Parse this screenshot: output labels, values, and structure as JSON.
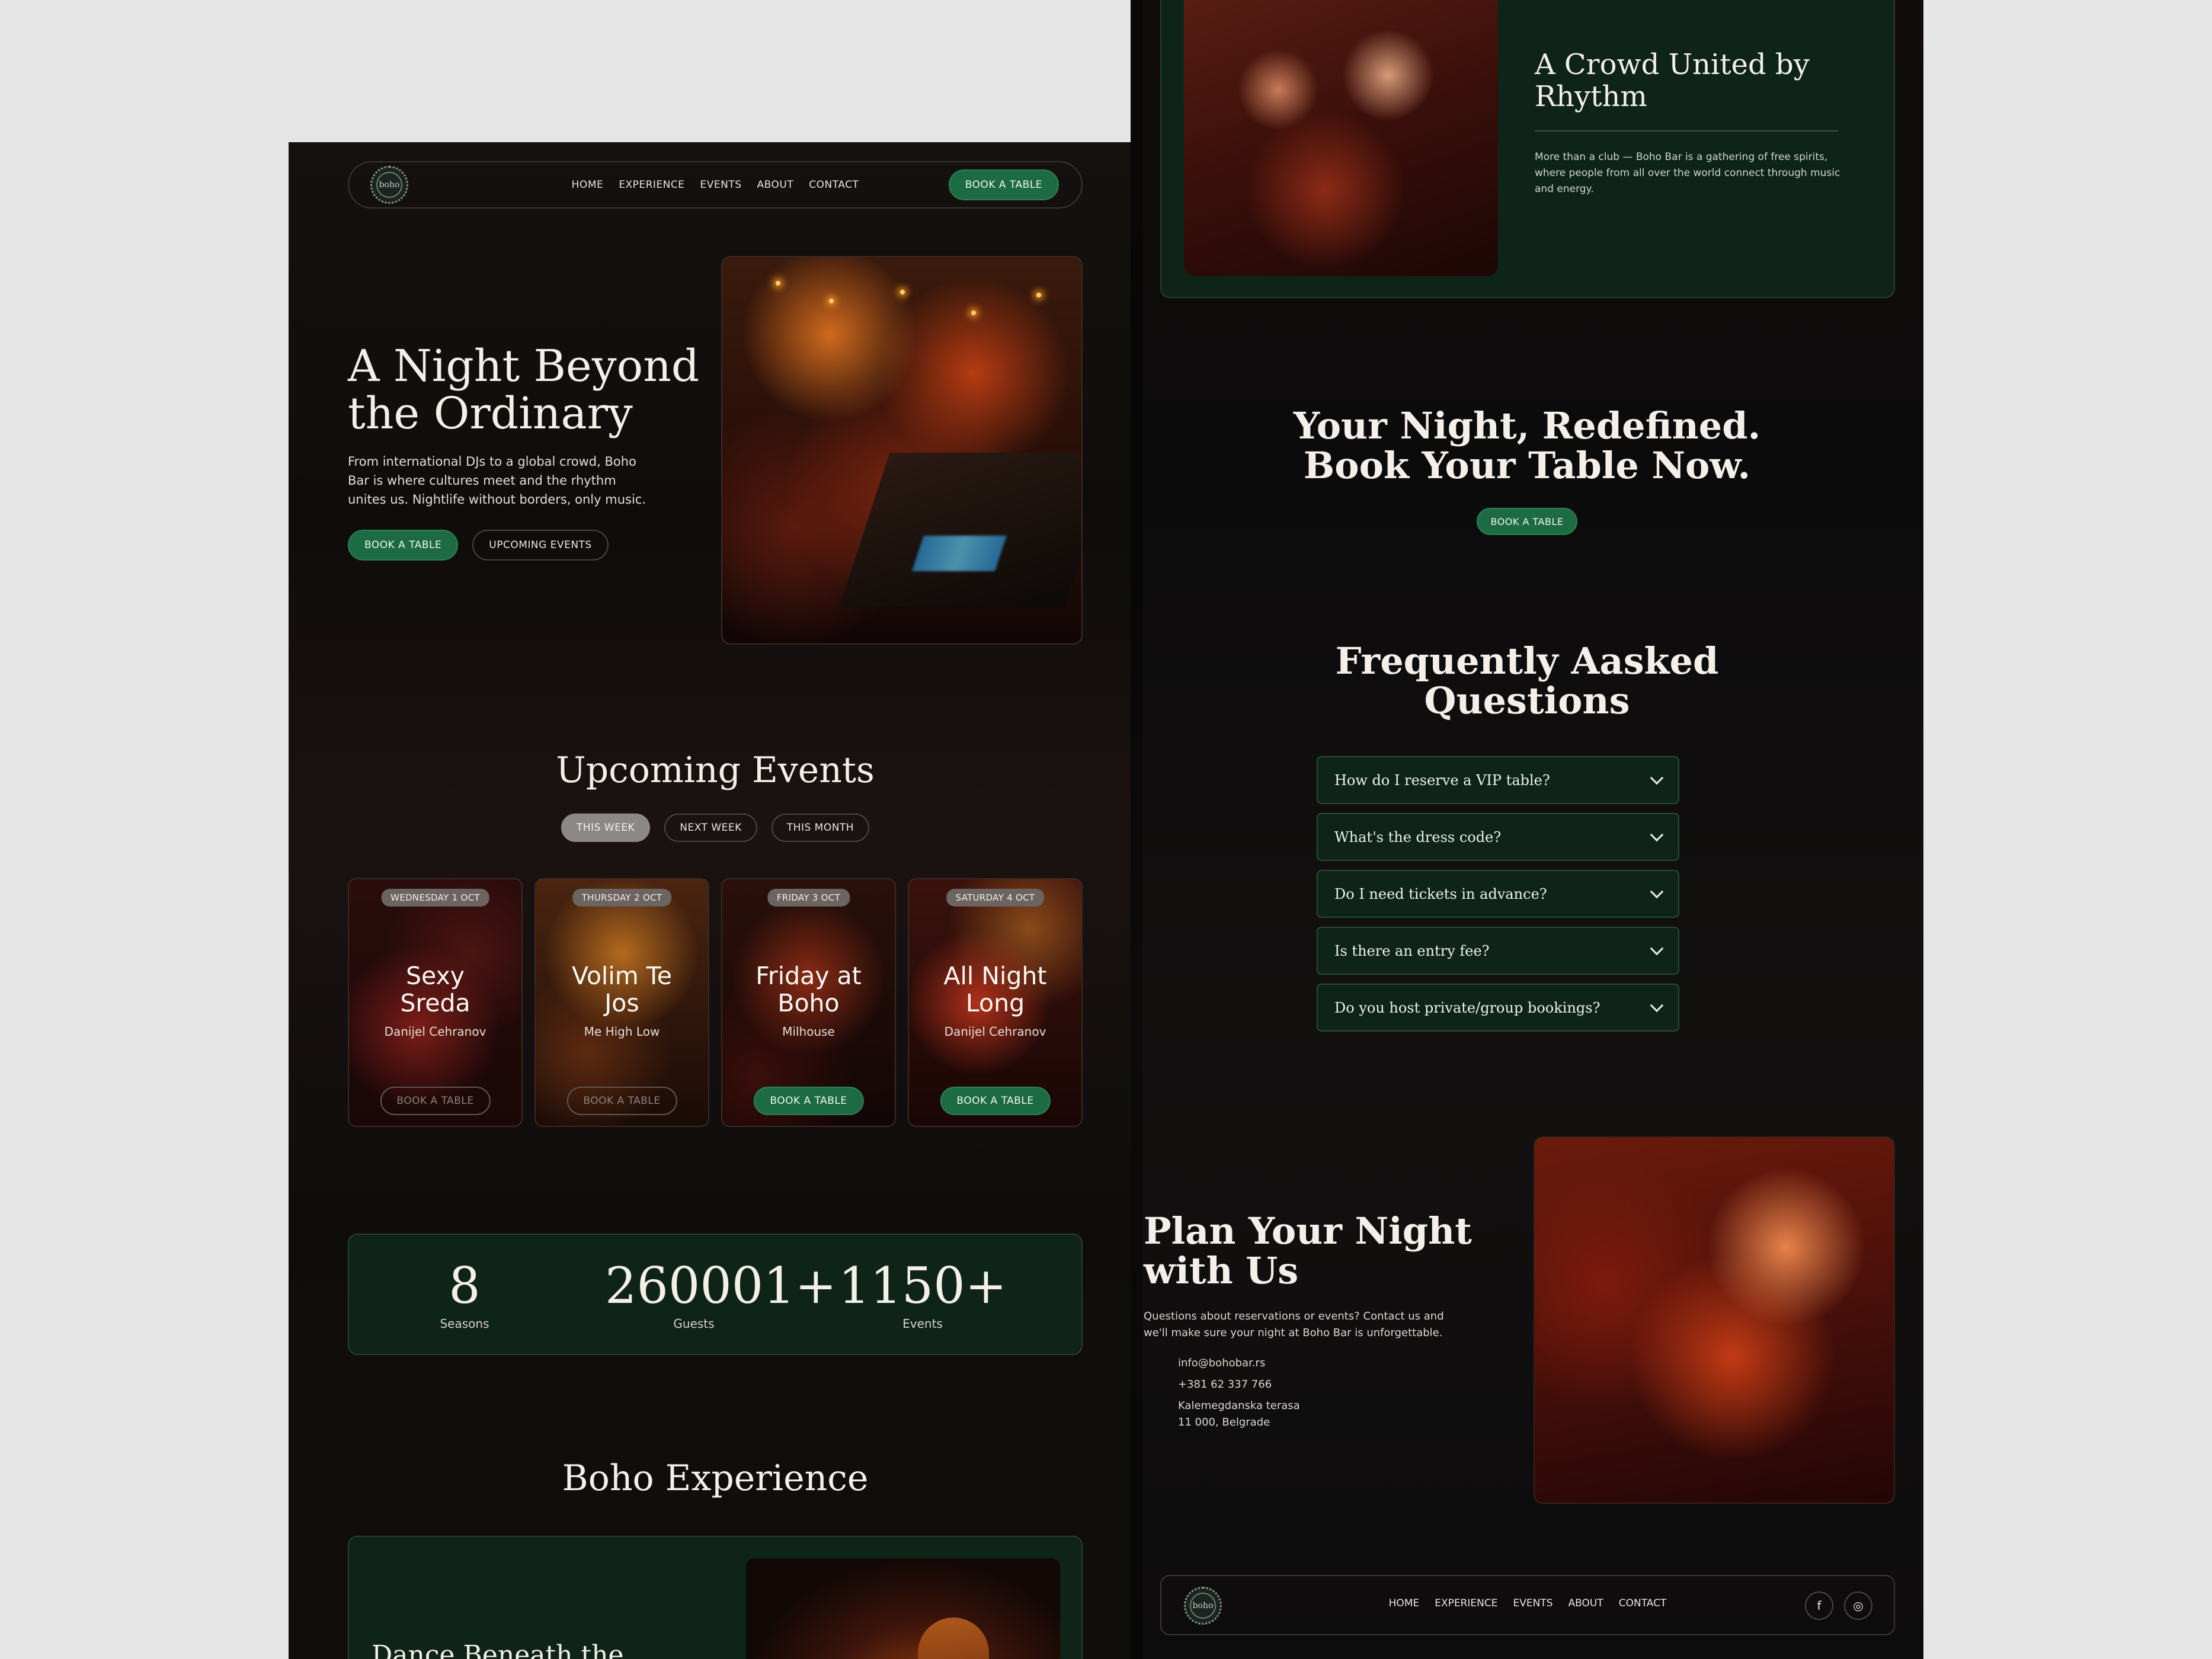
{
  "nav": {
    "links": [
      "HOME",
      "EXPERIENCE",
      "EVENTS",
      "ABOUT",
      "CONTACT"
    ],
    "cta": "BOOK A TABLE",
    "logo_text": "boho"
  },
  "hero": {
    "title_line1": "A Night Beyond",
    "title_line2": "the Ordinary",
    "text": "From international DJs to a global crowd, Boho Bar is where cultures meet and the rhythm unites us. Nightlife without borders, only music.",
    "btn_primary": "BOOK A TABLE",
    "btn_secondary": "UPCOMING EVENTS"
  },
  "events": {
    "title": "Upcoming Events",
    "tabs": [
      "THIS WEEK",
      "NEXT WEEK",
      "THIS MONTH"
    ],
    "active_tab": "THIS WEEK",
    "cards": [
      {
        "date": "WEDNESDAY 1 OCT",
        "name_line1": "Sexy",
        "name_line2": "Sreda",
        "artist": "Danijel Cehranov",
        "button": "BOOK A TABLE",
        "button_enabled": false
      },
      {
        "date": "THURSDAY 2 OCT",
        "name_line1": "Volim Te",
        "name_line2": "Jos",
        "artist": "Me High Low",
        "button": "BOOK A TABLE",
        "button_enabled": false
      },
      {
        "date": "FRIDAY 3 OCT",
        "name_line1": "Friday at",
        "name_line2": "Boho",
        "artist": "Milhouse",
        "button": "BOOK A TABLE",
        "button_enabled": true
      },
      {
        "date": "SATURDAY 4 OCT",
        "name_line1": "All Night",
        "name_line2": "Long",
        "artist": "Danijel Cehranov",
        "button": "BOOK A TABLE",
        "button_enabled": true
      }
    ]
  },
  "stats": [
    {
      "value": "8",
      "label": "Seasons"
    },
    {
      "value": "260001+",
      "label": "Guests"
    },
    {
      "value": "1150+",
      "label": "Events"
    }
  ],
  "experience": {
    "title": "Boho Experience",
    "card_title": "Dance Beneath the"
  },
  "crowd": {
    "title_line1": "A Crowd United by",
    "title_line2": "Rhythm",
    "text": "More than a club — Boho Bar is a gathering of free spirits, where people from all over the world connect through music and energy."
  },
  "cta": {
    "title_line1": "Your Night, Redefined.",
    "title_line2": "Book Your Table Now.",
    "button": "BOOK A TABLE"
  },
  "faq": {
    "title_line1": "Frequently Aasked",
    "title_line2": "Questions",
    "items": [
      "How do I reserve a VIP table?",
      "What's the dress code?",
      "Do I need tickets in advance?",
      "Is there an entry fee?",
      "Do you host private/group bookings?"
    ]
  },
  "plan": {
    "title_line1": "Plan Your Night",
    "title_line2": "with Us",
    "text": "Questions about reservations or events? Contact us and we'll make sure your night at Boho Bar is unforgettable.",
    "email": "info@bohobar.rs",
    "phone": "+381 62 337 766",
    "address_line1": "Kalemegdanska terasa",
    "address_line2": "11 000, Belgrade"
  },
  "footer": {
    "links": [
      "HOME",
      "EXPERIENCE",
      "EVENTS",
      "ABOUT",
      "CONTACT"
    ],
    "social_facebook": "f",
    "social_instagram": "◎"
  },
  "colors": {
    "accent_green": "#1d6b43",
    "card_green": "#0e2419",
    "background_dark": "#0f0c0b"
  }
}
